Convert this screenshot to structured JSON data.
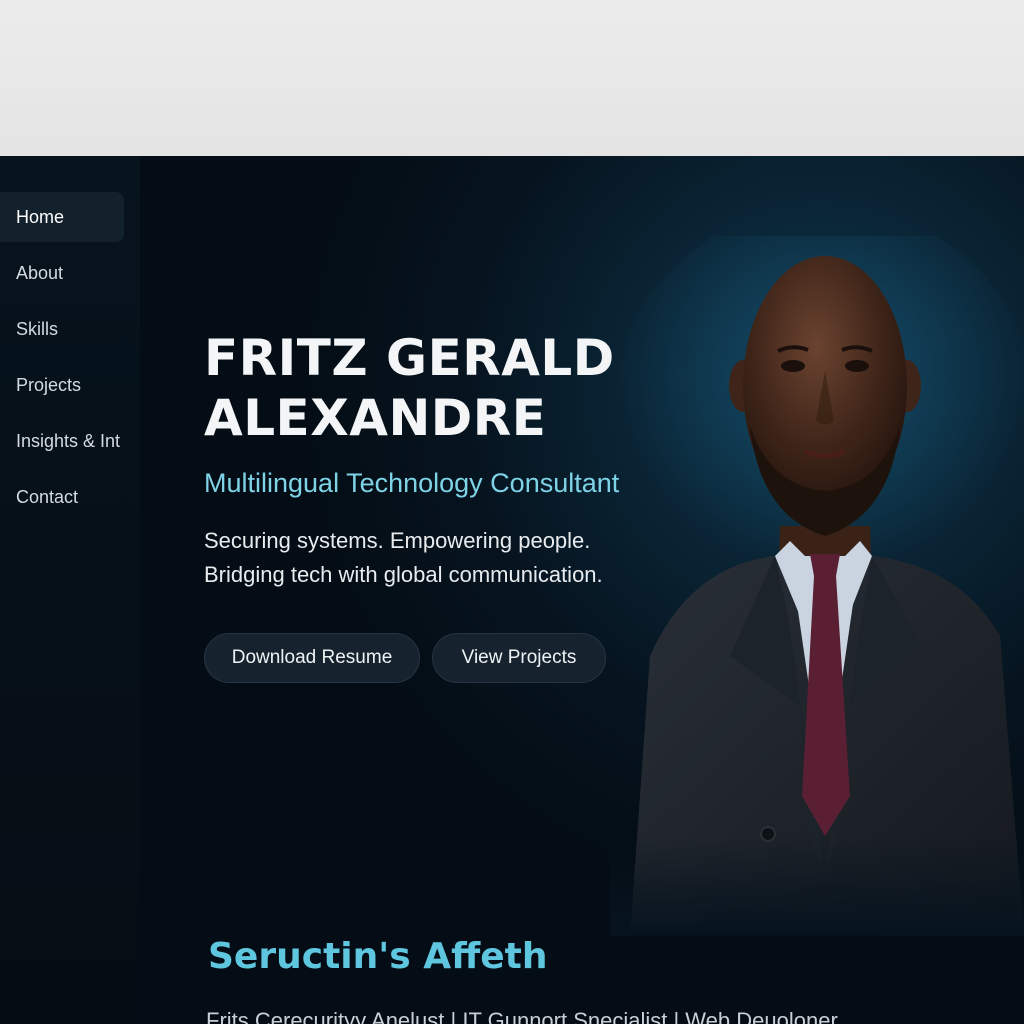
{
  "sidebar": {
    "items": [
      {
        "label": "Home",
        "active": true
      },
      {
        "label": "About",
        "active": false
      },
      {
        "label": "Skills",
        "active": false
      },
      {
        "label": "Projects",
        "active": false
      },
      {
        "label": "Insights & Int",
        "active": false
      },
      {
        "label": "Contact",
        "active": false
      }
    ]
  },
  "hero": {
    "name_line1": "FRITZ GERALD",
    "name_line2": "ALEXANDRE",
    "title": "Multilingual Technology Consultant",
    "tagline_line1": "Securing systems. Empowering people.",
    "tagline_line2": "Bridging tech with global communication.",
    "buttons": {
      "resume": "Download Resume",
      "projects": "View Projects"
    }
  },
  "section": {
    "title": "Seructin's Affeth",
    "roles": "Frits  Cerecurityy Anelust  |  IT Gunnort Snecialist  |  Web Deuoloner"
  },
  "colors": {
    "accent": "#7fd3e6",
    "background": "#06131e",
    "sidebar": "#07131d",
    "button": "#16232e"
  }
}
